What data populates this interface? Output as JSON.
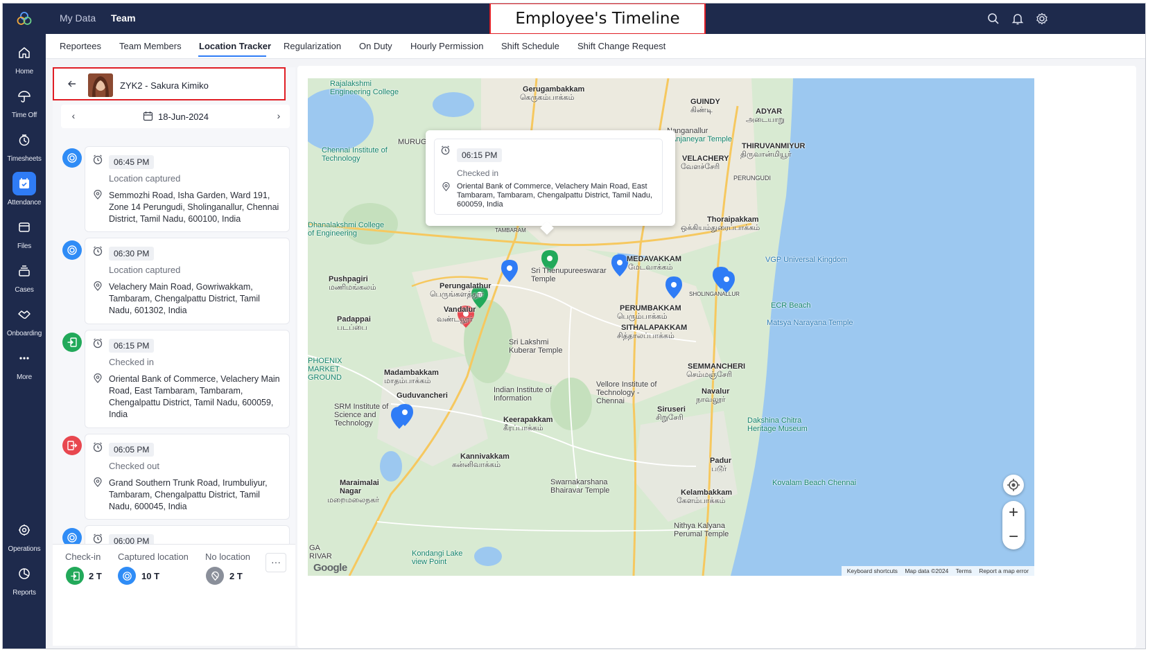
{
  "nav": {
    "items": [
      {
        "key": "home",
        "label": "Home",
        "icon": "home-icon"
      },
      {
        "key": "timeoff",
        "label": "Time Off",
        "icon": "umbrella-icon"
      },
      {
        "key": "timesheets",
        "label": "Timesheets",
        "icon": "timesheet-icon"
      },
      {
        "key": "attendance",
        "label": "Attendance",
        "icon": "calendar-check-icon"
      },
      {
        "key": "files",
        "label": "Files",
        "icon": "folder-icon"
      },
      {
        "key": "cases",
        "label": "Cases",
        "icon": "cases-icon"
      },
      {
        "key": "onboarding",
        "label": "Onboarding",
        "icon": "handshake-icon"
      },
      {
        "key": "more",
        "label": "More",
        "icon": "more-dots-icon"
      },
      {
        "key": "operations",
        "label": "Operations",
        "icon": "operations-icon"
      },
      {
        "key": "reports",
        "label": "Reports",
        "icon": "reports-icon"
      }
    ],
    "active": "attendance",
    "accent": "#2f7cf6"
  },
  "topbar": {
    "tabs": [
      "My Data",
      "Team"
    ],
    "active_tab": "Team",
    "annotation": "Employee's Timeline",
    "icons": [
      "search-icon",
      "bell-icon",
      "settings-gear-icon"
    ]
  },
  "subnav": {
    "tabs": [
      "Reportees",
      "Team Members",
      "Location Tracker",
      "Regularization",
      "On Duty",
      "Hourly Permission",
      "Shift Schedule",
      "Shift Change Request"
    ],
    "active": "Location Tracker"
  },
  "employee": {
    "name": "ZYK2 - Sakura Kimiko"
  },
  "date": {
    "value": "18-Jun-2024"
  },
  "timeline": [
    {
      "time": "06:45 PM",
      "status": "Location captured",
      "type": "captured",
      "address": "Semmozhi Road, Isha Garden, Ward 191, Zone 14 Perungudi, Sholinganallur, Chennai District, Tamil Nadu, 600100, India"
    },
    {
      "time": "06:30 PM",
      "status": "Location captured",
      "type": "captured",
      "address": "Velachery Main Road, Gowriwakkam, Tambaram, Chengalpattu District, Tamil Nadu, 601302, India"
    },
    {
      "time": "06:15 PM",
      "status": "Checked in",
      "type": "checkin",
      "address": "Oriental Bank of Commerce, Velachery Main Road, East Tambaram, Tambaram, Chengalpattu District, Tamil Nadu, 600059, India"
    },
    {
      "time": "06:05 PM",
      "status": "Checked out",
      "type": "checkout",
      "address": "Grand Southern Trunk Road, Irumbuliyur, Tambaram, Chengalpattu District, Tamil Nadu, 600045, India"
    },
    {
      "time": "06:00 PM",
      "status": "",
      "type": "captured",
      "address": ""
    }
  ],
  "legend": {
    "items": [
      {
        "label": "Check-in",
        "value": "2 T",
        "color": "#22a95a"
      },
      {
        "label": "Captured location",
        "value": "10 T",
        "color": "#2f8cf6"
      },
      {
        "label": "No location",
        "value": "2 T",
        "color": "#8a8f9a"
      }
    ],
    "more": "···"
  },
  "popup": {
    "time": "06:15 PM",
    "status": "Checked in",
    "address": "Oriental Bank of Commerce, Velachery Main Road, East Tambaram, Tambaram, Chengalpattu District, Tamil Nadu, 600059, India"
  },
  "map": {
    "labels": [
      {
        "text": "Rajalakshmi Engineering College",
        "cls": "poi"
      },
      {
        "text": "Gerugambakkam",
        "cls": "bold"
      },
      {
        "text": "கெருகம்பாக்கம்",
        "cls": ""
      },
      {
        "text": "GUINDY",
        "cls": "bold"
      },
      {
        "text": "கிண்டி",
        "cls": ""
      },
      {
        "text": "ADYAR",
        "cls": "bold"
      },
      {
        "text": "அடையாறு",
        "cls": ""
      },
      {
        "text": "Chennai Institute of Technology",
        "cls": "poi"
      },
      {
        "text": "MURUG",
        "cls": ""
      },
      {
        "text": "Nanganallur",
        "cls": ""
      },
      {
        "text": "Anjaneyar Temple",
        "cls": "poi"
      },
      {
        "text": "THIRUVANMIYUR",
        "cls": "bold"
      },
      {
        "text": "திருவான்மியூர்",
        "cls": ""
      },
      {
        "text": "VELACHERY",
        "cls": "bold"
      },
      {
        "text": "வேளச்சேரி",
        "cls": ""
      },
      {
        "text": "PERUNGUDI",
        "cls": ""
      },
      {
        "text": "Dhanalakshmi College of Engineering",
        "cls": "poi"
      },
      {
        "text": "Thoraipakkam",
        "cls": "bold"
      },
      {
        "text": "ஒக்கியம்துரைப்பாக்கம்",
        "cls": ""
      },
      {
        "text": "TAMBARAM",
        "cls": ""
      },
      {
        "text": "MEDAVAKKAM",
        "cls": "bold"
      },
      {
        "text": "மேடவாக்கம்",
        "cls": ""
      },
      {
        "text": "VGP Universal Kingdom",
        "cls": "poi2"
      },
      {
        "text": "Sri Thenupureeswarar Temple",
        "cls": ""
      },
      {
        "text": "Pushpagiri",
        "cls": "bold"
      },
      {
        "text": "மணிமங்கலம்",
        "cls": ""
      },
      {
        "text": "Perungalathur",
        "cls": "bold"
      },
      {
        "text": "பெருங்களத்தூர்",
        "cls": ""
      },
      {
        "text": "SHOLINGANALLUR",
        "cls": ""
      },
      {
        "text": "ECR Beach",
        "cls": "poi"
      },
      {
        "text": "Padappai",
        "cls": "bold"
      },
      {
        "text": "படப்பை",
        "cls": ""
      },
      {
        "text": "Vandalur",
        "cls": "bold"
      },
      {
        "text": "வண்டலூர்",
        "cls": ""
      },
      {
        "text": "PERUMBAKKAM",
        "cls": "bold"
      },
      {
        "text": "பெரும்பாக்கம்",
        "cls": ""
      },
      {
        "text": "Matsya Narayana Temple",
        "cls": "poi2"
      },
      {
        "text": "SITHALAPAKKAM",
        "cls": "bold"
      },
      {
        "text": "சித்தாலப்பாக்கம்",
        "cls": ""
      },
      {
        "text": "Sri Lakshmi Kuberar Temple",
        "cls": ""
      },
      {
        "text": "PHOENIX MARKET GROUND",
        "cls": "poi"
      },
      {
        "text": "Madambakkam",
        "cls": "bold"
      },
      {
        "text": "மாதம்பாக்கம்",
        "cls": ""
      },
      {
        "text": "SEMMANCHERI",
        "cls": "bold"
      },
      {
        "text": "செம்மஞ்சேரி",
        "cls": ""
      },
      {
        "text": "Guduvancheri",
        "cls": "bold"
      },
      {
        "text": "Indian Institute of Information",
        "cls": ""
      },
      {
        "text": "Vellore Institute of Technology - Chennai",
        "cls": ""
      },
      {
        "text": "Navalur",
        "cls": "bold"
      },
      {
        "text": "நாவலூர்",
        "cls": ""
      },
      {
        "text": "SRM Institute of Science and Technology",
        "cls": ""
      },
      {
        "text": "Siruseri",
        "cls": "bold"
      },
      {
        "text": "சிறுசேரி",
        "cls": ""
      },
      {
        "text": "Keerapakkam",
        "cls": "bold"
      },
      {
        "text": "கீரப்பாக்கம்",
        "cls": ""
      },
      {
        "text": "Dakshina Chitra Heritage Museum",
        "cls": "poi"
      },
      {
        "text": "Kannivakkam",
        "cls": "bold"
      },
      {
        "text": "கன்னிவாக்கம்",
        "cls": ""
      },
      {
        "text": "Padur",
        "cls": "bold"
      },
      {
        "text": "படூர்",
        "cls": ""
      },
      {
        "text": "Maraimalai Nagar",
        "cls": "bold"
      },
      {
        "text": "மறைமலைநகர்",
        "cls": ""
      },
      {
        "text": "Swarnakarshana Bhairavar Temple",
        "cls": ""
      },
      {
        "text": "Kovalam Beach Chennai",
        "cls": "poi"
      },
      {
        "text": "Kelambakkam",
        "cls": "bold"
      },
      {
        "text": "கேளம்பாக்கம்",
        "cls": ""
      },
      {
        "text": "Nithya Kalyana Perumal Temple",
        "cls": ""
      },
      {
        "text": "Kondangi Lake view Point",
        "cls": "poi"
      },
      {
        "text": "GA RIVAR",
        "cls": ""
      }
    ],
    "attribution": [
      "Keyboard shortcuts",
      "Map data ©2024",
      "Terms",
      "Report a map error"
    ],
    "logo": "Google",
    "controls": {
      "zoom_in": "+",
      "zoom_out": "−"
    }
  }
}
